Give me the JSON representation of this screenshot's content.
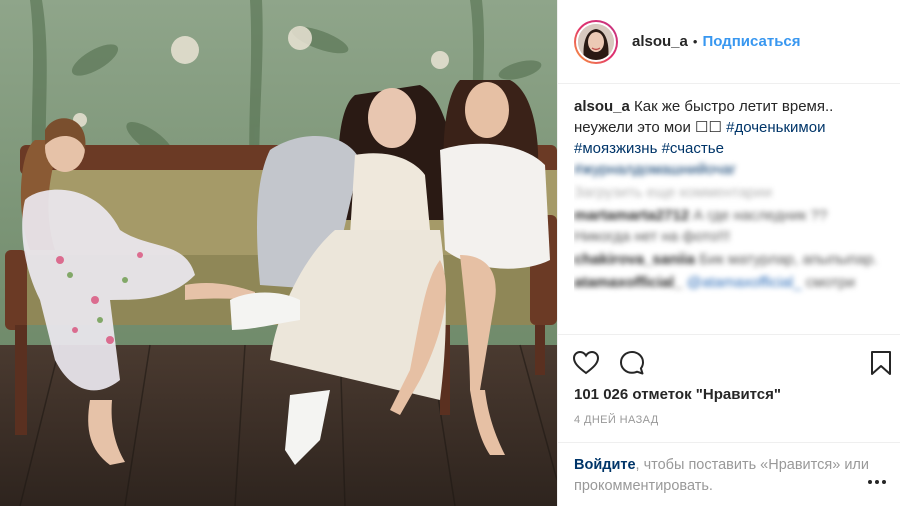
{
  "post": {
    "photo_alt": "",
    "author": {
      "username": "alsou_a",
      "separator": "•",
      "follow_label": "Подписаться"
    },
    "caption": {
      "username": "alsou_a",
      "text": "Как же быстро летит время.. неужели это мои ☐☐",
      "hashtags": [
        "#доченькимои",
        "#моязжизнь",
        "#счастье",
        "#журналдомашнийочаг"
      ]
    },
    "load_more_label": "Загрузить еще комментарии",
    "comments": [
      {
        "username": "martamarta2712",
        "text": "А где наследник ?? Никогда нет на фото!!!"
      },
      {
        "username": "chakirova_saniia",
        "text": "Бик матурлар, апыпыпар."
      },
      {
        "username": "atamaxofficial_",
        "mention": "@atamaxofficial_",
        "text": "смотри"
      }
    ],
    "likes": {
      "count": "101 026",
      "label": "отметок \"Нравится\""
    },
    "timestamp": "4 ДНЕЙ НАЗАД",
    "footer": {
      "login_label": "Войдите",
      "text": ", чтобы поставить «Нравится» или прокомментировать."
    }
  },
  "icons": {
    "like": "heart-icon",
    "comment": "comment-icon",
    "save": "bookmark-icon",
    "more": "more-options-icon"
  },
  "colors": {
    "link": "#3897f0",
    "hashtag": "#003569",
    "text": "#262626",
    "muted": "#999999"
  }
}
